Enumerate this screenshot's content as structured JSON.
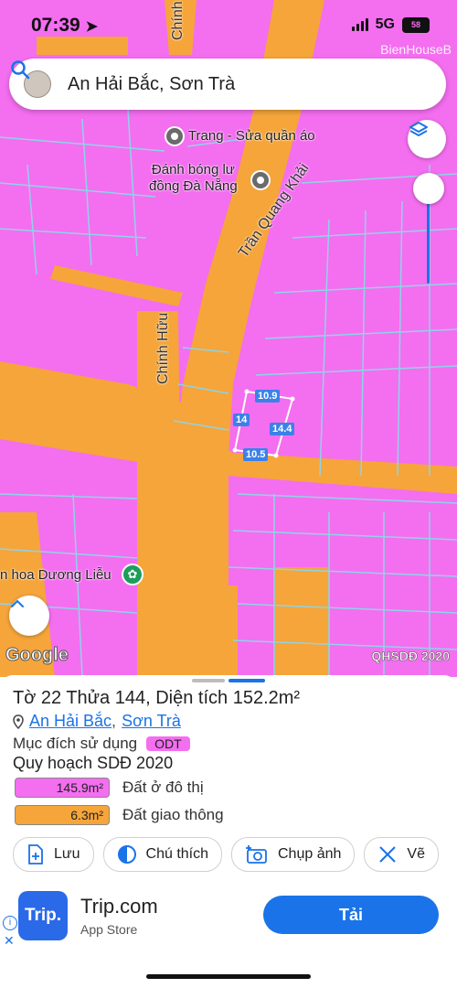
{
  "status": {
    "time": "07:39",
    "network": "5G",
    "battery": "58"
  },
  "watermark": "BienHouseB",
  "search": {
    "query": "An Hải Bắc, Sơn Trà"
  },
  "map": {
    "poi1": "Trang - Sửa quần áo",
    "poi2_line1": "Đánh bóng lư",
    "poi2_line2": "đồng Đà Nẵng",
    "street1": "Trần Quang Khải",
    "street2": "Chính Hữu",
    "street3": "Chính",
    "poi3": "n hoa Dương Liễu",
    "dims": {
      "top": "10.9",
      "left": "14",
      "right": "14.4",
      "bottom": "10.5"
    },
    "logo": "Google",
    "overlay_tag": "QHSDĐ 2020",
    "colors": {
      "residential": "#f46ef0",
      "road": "#f5a53a",
      "parcel_line": "#8fd3e8"
    }
  },
  "sheet": {
    "title": "Tờ 22 Thửa 144, Diện tích 152.2m²",
    "ward": "An Hải Bắc",
    "separator": ",",
    "district": "Sơn Trà",
    "purpose_label": "Mục đích sử dụng",
    "purpose_code": "ODT",
    "planning_title": "Quy hoạch SDĐ 2020",
    "legend": [
      {
        "area": "145.9m²",
        "label": "Đất ở đô thị",
        "color": "#f46ef0"
      },
      {
        "area": "6.3m²",
        "label": "Đất giao thông",
        "color": "#f5a53a"
      }
    ],
    "actions": [
      {
        "label": "Lưu",
        "icon": "add-document-icon"
      },
      {
        "label": "Chú thích",
        "icon": "half-circle-icon"
      },
      {
        "label": "Chụp ảnh",
        "icon": "camera-plus-icon"
      },
      {
        "label": "Vẽ",
        "icon": "ruler-pencil-icon"
      }
    ]
  },
  "ad": {
    "logo_text": "Trip.",
    "name": "Trip.com",
    "store": "App Store",
    "button": "Tải"
  }
}
